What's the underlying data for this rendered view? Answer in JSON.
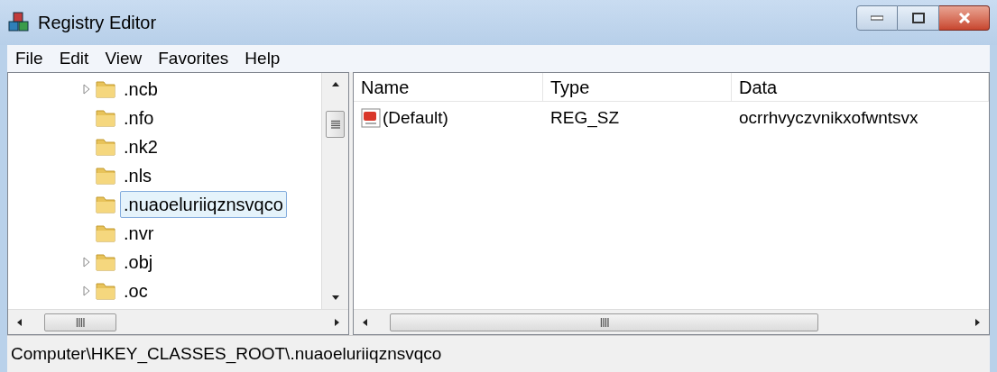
{
  "window": {
    "title": "Registry Editor"
  },
  "menu": [
    "File",
    "Edit",
    "View",
    "Favorites",
    "Help"
  ],
  "tree": {
    "items": [
      {
        "label": ".ncb",
        "has_children": true,
        "selected": false
      },
      {
        "label": ".nfo",
        "has_children": false,
        "selected": false
      },
      {
        "label": ".nk2",
        "has_children": false,
        "selected": false
      },
      {
        "label": ".nls",
        "has_children": false,
        "selected": false
      },
      {
        "label": ".nuaoeluriiqznsvqco",
        "has_children": false,
        "selected": true
      },
      {
        "label": ".nvr",
        "has_children": false,
        "selected": false
      },
      {
        "label": ".obj",
        "has_children": true,
        "selected": false
      },
      {
        "label": ".oc",
        "has_children": true,
        "selected": false
      }
    ]
  },
  "values": {
    "columns": [
      "Name",
      "Type",
      "Data"
    ],
    "rows": [
      {
        "name": "(Default)",
        "type": "REG_SZ",
        "data": "ocrrhvyczvnikxofwntsvx"
      }
    ]
  },
  "status_bar": "Computer\\HKEY_CLASSES_ROOT\\.nuaoeluriiqznsvqco"
}
